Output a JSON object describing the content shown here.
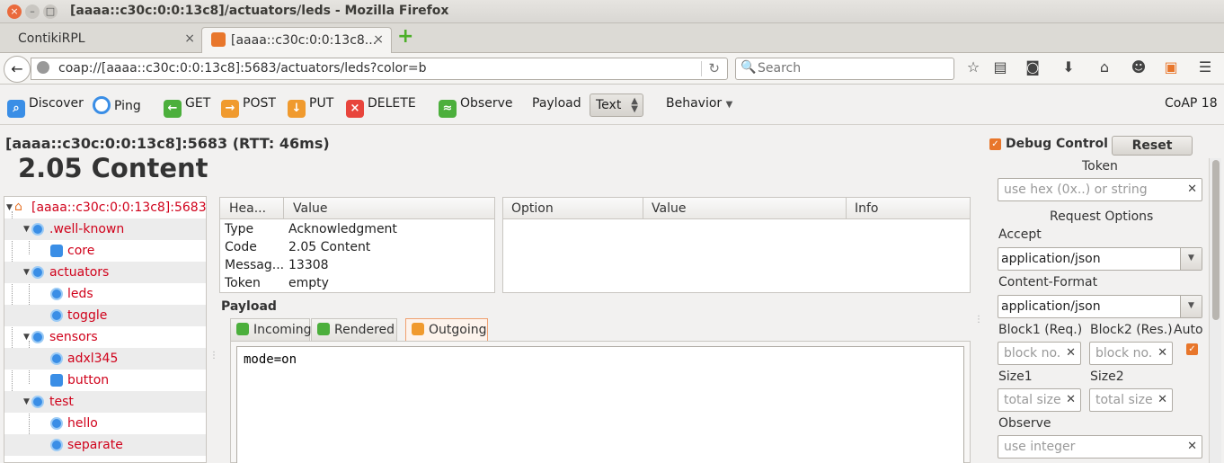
{
  "window": {
    "title": "[aaaa::c30c:0:0:13c8]/actuators/leds - Mozilla Firefox"
  },
  "tabs": [
    {
      "label": "ContikiRPL"
    },
    {
      "label": "[aaaa::c30c:0:0:13c8..."
    }
  ],
  "navbar": {
    "url": "coap://[aaaa::c30c:0:0:13c8]:5683/actuators/leds?color=b",
    "search_placeholder": "Search"
  },
  "toolbar": {
    "discover": "Discover",
    "ping": "Ping",
    "get": "GET",
    "post": "POST",
    "put": "PUT",
    "delete": "DELETE",
    "observe": "Observe",
    "payload": "Payload",
    "payload_format": "Text",
    "behavior": "Behavior",
    "version": "CoAP 18"
  },
  "status": {
    "endpoint": "[aaaa::c30c:0:0:13c8]:5683 (RTT: 46ms)",
    "code": "2.05 Content"
  },
  "tree": {
    "root": "[aaaa::c30c:0:0:13c8]:5683",
    "items": [
      {
        "label": ".well-known"
      },
      {
        "label": "core"
      },
      {
        "label": "actuators"
      },
      {
        "label": "leds"
      },
      {
        "label": "toggle"
      },
      {
        "label": "sensors"
      },
      {
        "label": "adxl345"
      },
      {
        "label": "button"
      },
      {
        "label": "test"
      },
      {
        "label": "hello"
      },
      {
        "label": "separate"
      }
    ]
  },
  "headers": {
    "columns": [
      "Hea...",
      "Value"
    ],
    "rows": [
      {
        "name": "Type",
        "value": "Acknowledgment"
      },
      {
        "name": "Code",
        "value": "2.05 Content"
      },
      {
        "name": "Messag...",
        "value": "13308"
      },
      {
        "name": "Token",
        "value": "empty"
      }
    ]
  },
  "options": {
    "columns": [
      "Option",
      "Value",
      "Info"
    ]
  },
  "payload": {
    "label": "Payload",
    "tabs": [
      "Incoming",
      "Rendered",
      "Outgoing"
    ],
    "outgoing_text": "mode=on"
  },
  "debug": {
    "label": "Debug Control",
    "reset": "Reset",
    "token_label": "Token",
    "token_placeholder": "use hex (0x..) or string",
    "request_options": "Request Options",
    "accept_label": "Accept",
    "accept_value": "application/json",
    "content_format_label": "Content-Format",
    "content_format_value": "application/json",
    "block1_label": "Block1 (Req.)",
    "block2_label": "Block2 (Res.)",
    "block_placeholder": "block no.",
    "auto_label": "Auto",
    "size1_label": "Size1",
    "size2_label": "Size2",
    "size_placeholder": "total size",
    "observe_label": "Observe",
    "observe_placeholder": "use integer"
  },
  "colors": {
    "accent": "#e8762b",
    "link_red": "#d0021b",
    "icon_blue": "#3a8ee6"
  }
}
